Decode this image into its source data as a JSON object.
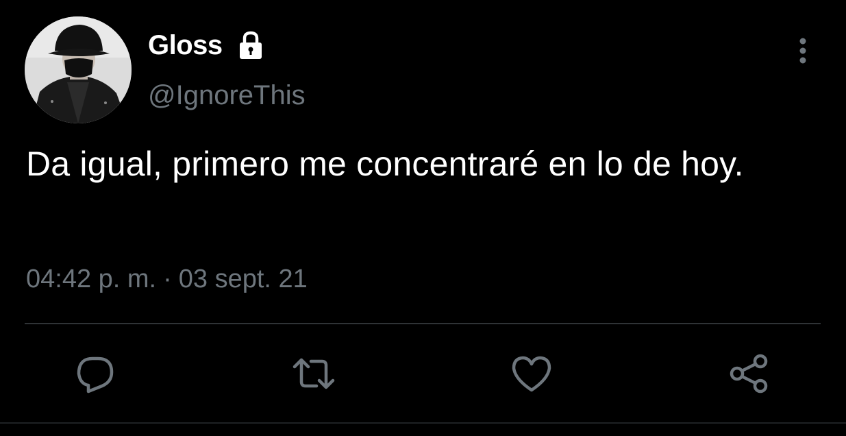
{
  "author": {
    "display_name": "Gloss",
    "handle": "@IgnoreThis",
    "protected": true
  },
  "tweet": {
    "text": "Da igual, primero me concentraré en lo de hoy.",
    "time": "04:42 p. m.",
    "separator": "·",
    "date": "03 sept. 21"
  },
  "icons": {
    "avatar": "profile-photo",
    "lock": "lock-icon",
    "more": "more-vertical-icon",
    "reply": "reply-icon",
    "retweet": "retweet-icon",
    "like": "like-icon",
    "share": "share-icon"
  },
  "colors": {
    "background": "#000000",
    "text_primary": "#ffffff",
    "text_secondary": "#6e767d",
    "divider": "#2f3336",
    "icon": "#6e767d"
  }
}
